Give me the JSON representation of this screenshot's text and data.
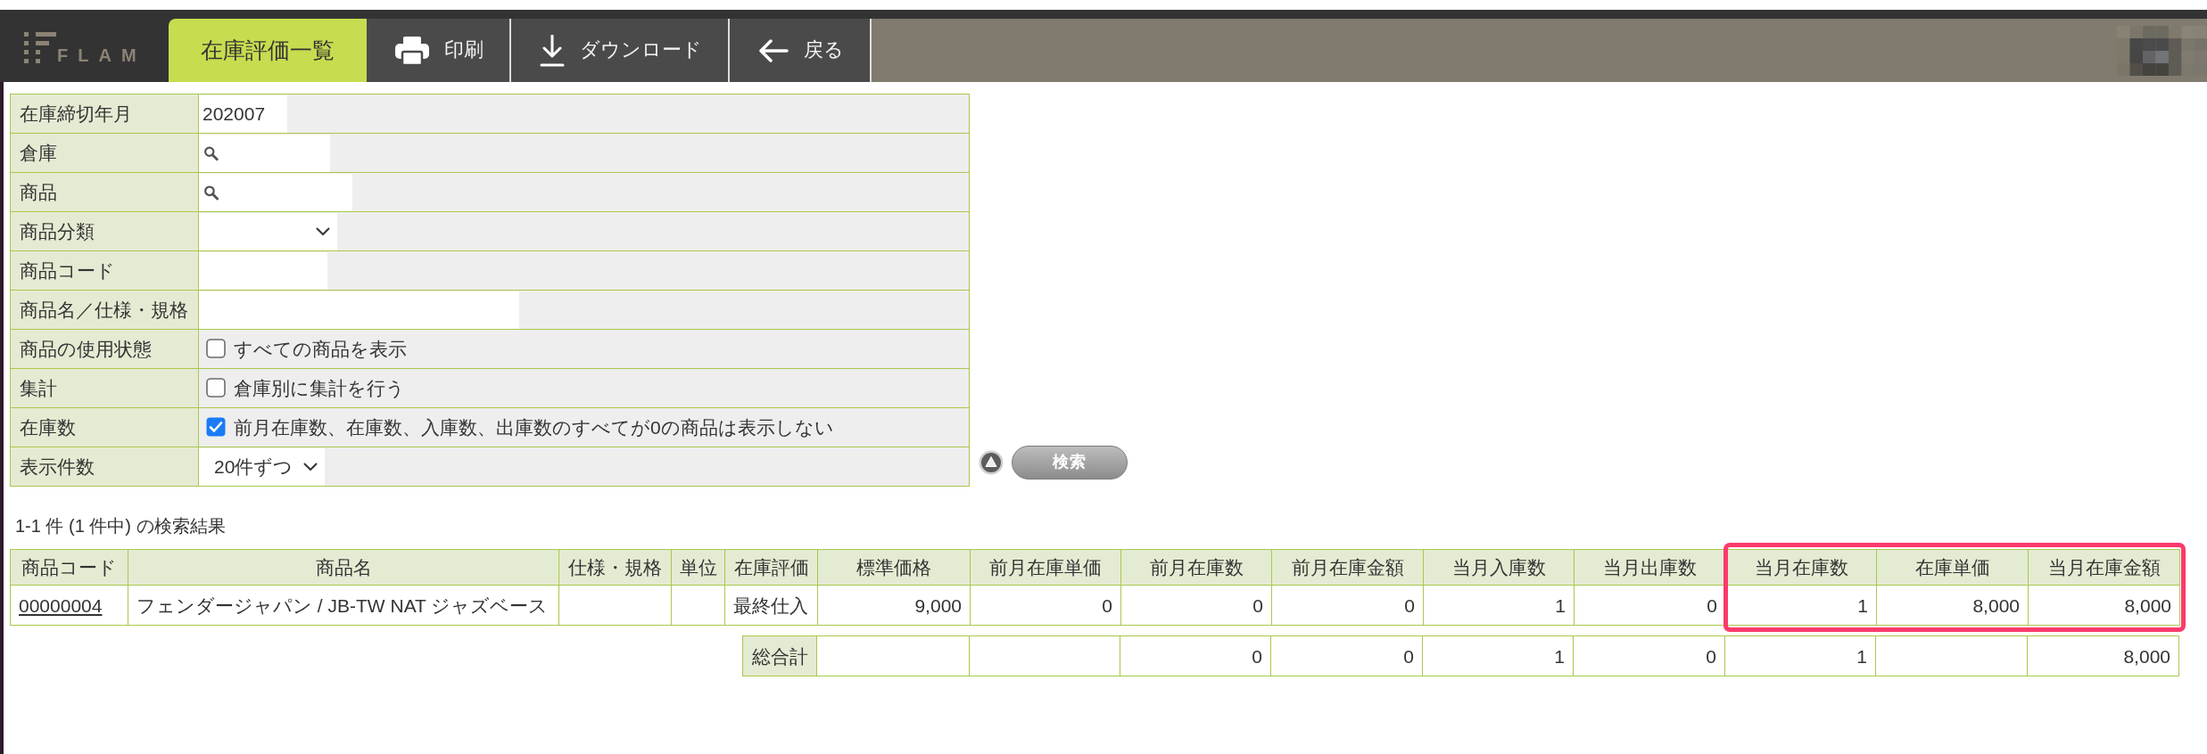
{
  "header": {
    "logo": "FLAM",
    "tabs": [
      {
        "label": "在庫評価一覧",
        "selected": true
      }
    ],
    "actions": [
      {
        "label": "印刷",
        "kind": "print"
      },
      {
        "label": "ダウンロード",
        "kind": "download"
      },
      {
        "label": "戻る",
        "kind": "back"
      }
    ]
  },
  "search_form": {
    "fields": [
      {
        "label": "在庫締切年月",
        "kind": "text",
        "value": "202007"
      },
      {
        "label": "倉庫",
        "kind": "lookup"
      },
      {
        "label": "商品",
        "kind": "lookup"
      },
      {
        "label": "商品分類",
        "kind": "select"
      },
      {
        "label": "商品コード",
        "kind": "text"
      },
      {
        "label": "商品名／仕様・規格",
        "kind": "text"
      },
      {
        "label": "商品の使用状態",
        "kind": "checkbox",
        "text": "すべての商品を表示",
        "checked": false
      },
      {
        "label": "集計",
        "kind": "checkbox",
        "text": "倉庫別に集計を行う",
        "checked": false
      },
      {
        "label": "在庫数",
        "kind": "checkbox",
        "text": "前月在庫数、在庫数、入庫数、出庫数のすべてが0の商品は表示しない",
        "checked": true
      },
      {
        "label": "表示件数",
        "kind": "select",
        "value": "20件ずつ"
      }
    ],
    "search_button": "検索"
  },
  "results": {
    "summary": "1-1 件 (1 件中) の検索結果",
    "columns": [
      {
        "label": "商品コード",
        "kind": "link",
        "highlighted": false
      },
      {
        "label": "商品名",
        "kind": "text",
        "highlighted": false
      },
      {
        "label": "仕様・規格",
        "kind": "text",
        "highlighted": false
      },
      {
        "label": "単位",
        "kind": "text",
        "highlighted": false
      },
      {
        "label": "在庫評価",
        "kind": "text",
        "highlighted": false
      },
      {
        "label": "標準価格",
        "kind": "number",
        "highlighted": false
      },
      {
        "label": "前月在庫単価",
        "kind": "number",
        "highlighted": false
      },
      {
        "label": "前月在庫数",
        "kind": "number",
        "highlighted": false
      },
      {
        "label": "前月在庫金額",
        "kind": "number",
        "highlighted": false
      },
      {
        "label": "当月入庫数",
        "kind": "number",
        "highlighted": false
      },
      {
        "label": "当月出庫数",
        "kind": "number",
        "highlighted": false
      },
      {
        "label": "当月在庫数",
        "kind": "number",
        "highlighted": true
      },
      {
        "label": "在庫単価",
        "kind": "number",
        "highlighted": true
      },
      {
        "label": "当月在庫金額",
        "kind": "number",
        "highlighted": true
      }
    ],
    "rows": [
      {
        "cells": [
          "00000004",
          "フェンダージャパン / JB-TW NAT ジャズベース",
          null,
          null,
          "最終仕入",
          "9,000",
          "0",
          "0",
          "0",
          "1",
          "0",
          "1",
          "8,000",
          "8,000"
        ]
      }
    ],
    "totals": {
      "label": "総合計",
      "cells": [
        null,
        null,
        "0",
        "0",
        "1",
        "0",
        "1",
        null,
        "8,000"
      ]
    }
  }
}
